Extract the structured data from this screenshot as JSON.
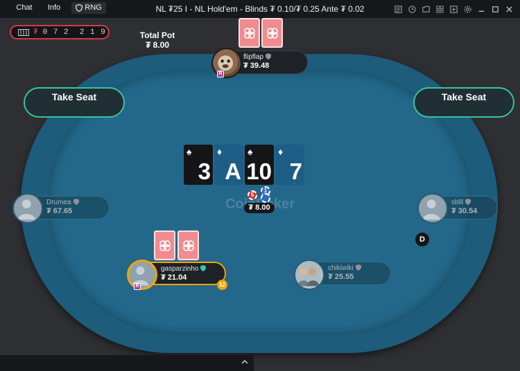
{
  "window": {
    "title": "NL ₮25 I - NL Hold'em - Blinds ₮ 0.10/₮ 0.25 Ante ₮ 0.02"
  },
  "title_bar_icons": [
    "notes-icon",
    "history-icon",
    "chat-box-icon",
    "tiles-icon",
    "add-table-icon",
    "settings-icon",
    "minimize-icon",
    "maximize-icon",
    "close-icon"
  ],
  "odometer": {
    "currency": "₮",
    "digits": "0 7 2  2 1 9"
  },
  "pot": {
    "title": "Total Pot",
    "total": "₮ 8.00",
    "center_amount": "₮ 8.00",
    "chip_red": "5",
    "chip_blue": "1"
  },
  "take_seat": {
    "left": "Take Seat",
    "right": "Take Seat"
  },
  "board": [
    {
      "rank": "3",
      "suit": "♠",
      "color": "black"
    },
    {
      "rank": "A",
      "suit": "♦",
      "color": "blue"
    },
    {
      "rank": "10",
      "suit": "♠",
      "color": "black"
    },
    {
      "rank": "7",
      "suit": "♦",
      "color": "blue"
    }
  ],
  "logo": "CoinPoker",
  "players": {
    "top": {
      "name": "flipflap",
      "stack": "₮ 39.48"
    },
    "left": {
      "name": "Drumea",
      "stack": "₮ 67.65"
    },
    "right": {
      "name": "sblll",
      "stack": "₮ 30.54"
    },
    "hero": {
      "name": "gasparzinho",
      "stack": "₮ 21.04",
      "timer": "12"
    },
    "bottom_right": {
      "name": "chikiwiki",
      "stack": "₮ 25.55"
    }
  },
  "dealer_button": "D",
  "bottom_bar": {
    "chat": "Chat",
    "info": "Info",
    "rng": "RNG"
  },
  "colors": {
    "felt": "#23688a",
    "rail": "#1d5c7b",
    "accent": "#35c6a2",
    "timer": "#f2a500",
    "card_back": "#f08c8f"
  }
}
